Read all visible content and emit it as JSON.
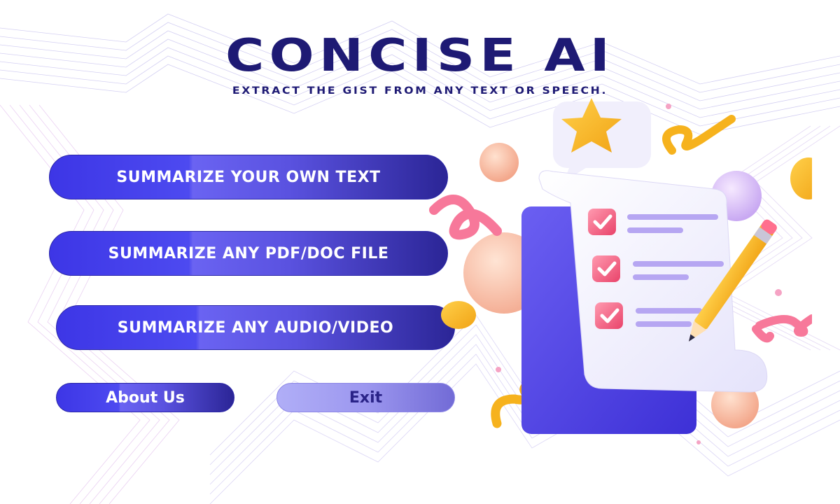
{
  "app": {
    "title": "CONCISE AI",
    "subtitle": "EXTRACT THE GIST FROM ANY TEXT OR SPEECH."
  },
  "menu": {
    "summarize_text": "SUMMARIZE YOUR OWN TEXT",
    "summarize_pdf": "SUMMARIZE ANY PDF/DOC FILE",
    "summarize_audio": "SUMMARIZE ANY AUDIO/VIDEO",
    "about": "About Us",
    "exit": "Exit"
  },
  "colors": {
    "title": "#1e1a74",
    "button_primary": "#3d36e6",
    "button_dark": "#2b2596",
    "button_exit": "#b0aef7",
    "accent_pink": "#f25c7a",
    "accent_yellow": "#f7b82a"
  },
  "icons": {
    "illustration": "checklist-document-icon",
    "pencil": "pencil-icon",
    "star": "star-icon",
    "check": "checkmark-icon"
  }
}
